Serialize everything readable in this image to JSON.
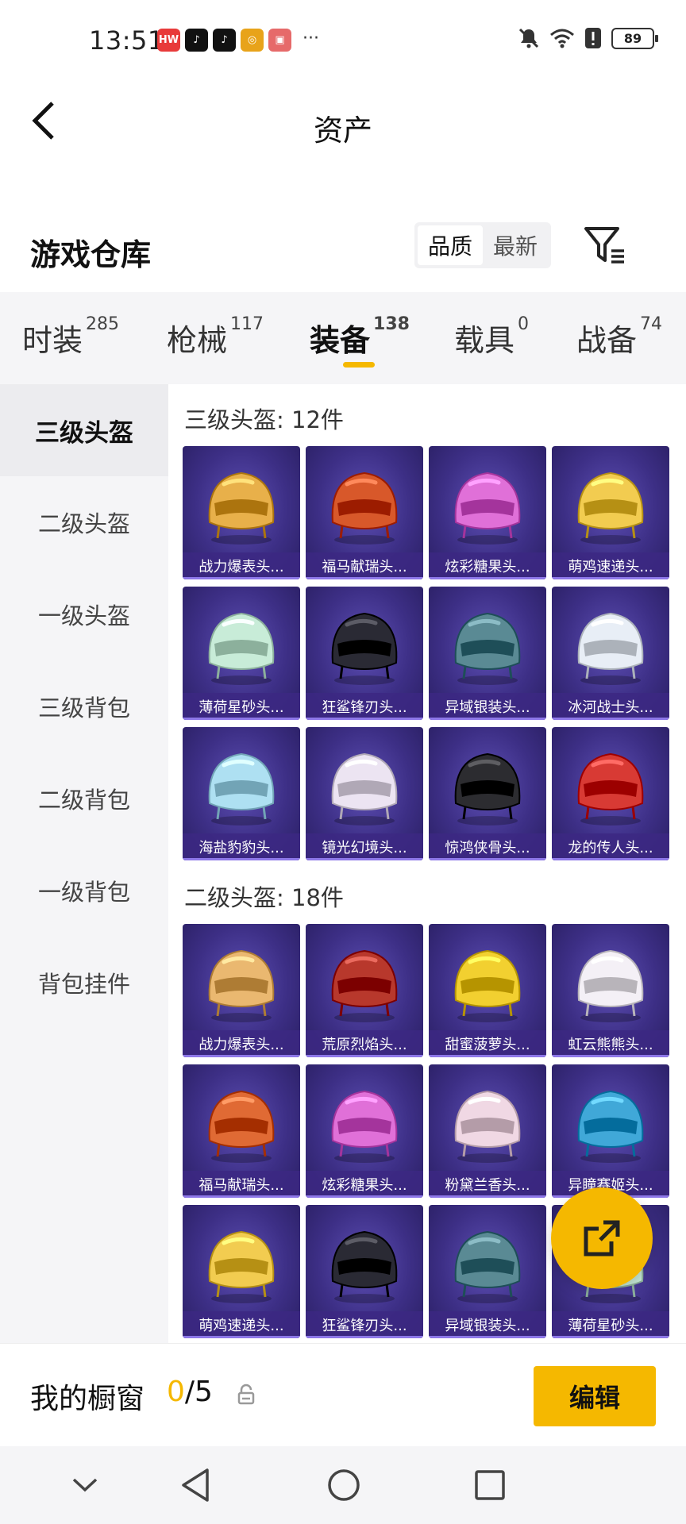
{
  "status_bar": {
    "time": "13:51",
    "apps": [
      {
        "name": "huawei-app-icon",
        "color": "#e83a3a",
        "glyph": "HW"
      },
      {
        "name": "tiktok-app-icon",
        "color": "#111111",
        "glyph": "♪"
      },
      {
        "name": "tiktok-app-icon-2",
        "color": "#111111",
        "glyph": "♪"
      },
      {
        "name": "target-app-icon",
        "color": "#e8a31a",
        "glyph": "◎"
      },
      {
        "name": "box-app-icon",
        "color": "#e66a6a",
        "glyph": "▣"
      }
    ],
    "more": "···",
    "battery": "89"
  },
  "header": {
    "title": "资产"
  },
  "warehouse": {
    "title": "游戏仓库",
    "sort_options": [
      "品质",
      "最新"
    ]
  },
  "tabs": [
    {
      "label": "时装",
      "count": "285"
    },
    {
      "label": "枪械",
      "count": "117"
    },
    {
      "label": "装备",
      "count": "138"
    },
    {
      "label": "载具",
      "count": "0"
    },
    {
      "label": "战备",
      "count": "74"
    }
  ],
  "sidebar": {
    "items": [
      "三级头盔",
      "二级头盔",
      "一级头盔",
      "三级背包",
      "二级背包",
      "一级背包",
      "背包挂件"
    ]
  },
  "sections": [
    {
      "title": "三级头盔: 12件",
      "items": [
        {
          "label": "战力爆表头...",
          "color": "#e8b04a"
        },
        {
          "label": "福马献瑞头...",
          "color": "#d8582a"
        },
        {
          "label": "炫彩糖果头...",
          "color": "#e070d8"
        },
        {
          "label": "萌鸡速递头...",
          "color": "#f2cc50"
        },
        {
          "label": "薄荷星砂头...",
          "color": "#c8ecd8"
        },
        {
          "label": "狂鲨锋刃头...",
          "color": "#2a2a34"
        },
        {
          "label": "异域银装头...",
          "color": "#5a8a94"
        },
        {
          "label": "冰河战士头...",
          "color": "#e8eef6"
        },
        {
          "label": "海盐豹豹头...",
          "color": "#aee0f2"
        },
        {
          "label": "镜光幻境头...",
          "color": "#ece4f2"
        },
        {
          "label": "惊鸿侠骨头...",
          "color": "#2c2c30"
        },
        {
          "label": "龙的传人头...",
          "color": "#d83a34"
        }
      ]
    },
    {
      "title": "二级头盔: 18件",
      "items": [
        {
          "label": "战力爆表头...",
          "color": "#eab870"
        },
        {
          "label": "荒原烈焰头...",
          "color": "#b8382c"
        },
        {
          "label": "甜蜜菠萝头...",
          "color": "#f2d030"
        },
        {
          "label": "虹云熊熊头...",
          "color": "#f4f0f6"
        },
        {
          "label": "福马献瑞头...",
          "color": "#e06a34"
        },
        {
          "label": "炫彩糖果头...",
          "color": "#e070d8"
        },
        {
          "label": "粉黛兰香头...",
          "color": "#f0d8e4"
        },
        {
          "label": "异瞳赛姬头...",
          "color": "#40a8d8"
        },
        {
          "label": "萌鸡速递头...",
          "color": "#f2cc50"
        },
        {
          "label": "狂鲨锋刃头...",
          "color": "#2a2a34"
        },
        {
          "label": "异域银装头...",
          "color": "#5a8a94"
        },
        {
          "label": "薄荷星砂头...",
          "color": "#c8ecd8"
        }
      ]
    }
  ],
  "showcase": {
    "label": "我的橱窗",
    "current": "0",
    "total": "/5",
    "edit_label": "编辑"
  },
  "colors": {
    "accent": "#f5b800",
    "card_bg": "#3d2f86"
  }
}
